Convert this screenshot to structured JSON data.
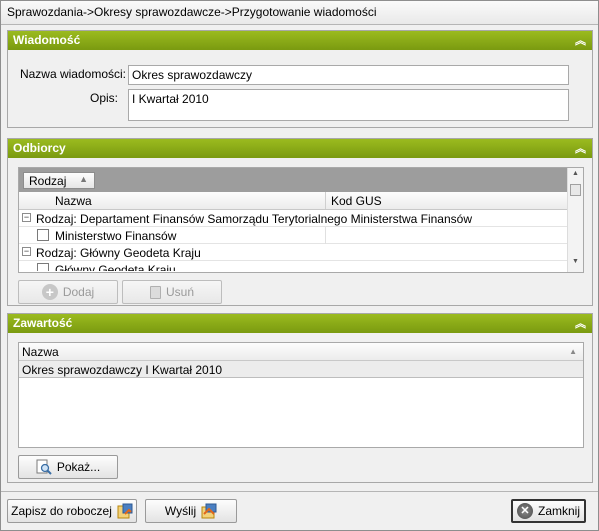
{
  "window": {
    "title": "Sprawozdania->Okresy sprawozdawcze->Przygotowanie wiadomości"
  },
  "message_group": {
    "header": "Wiadomość",
    "name_label": "Nazwa wiadomości:",
    "name_value": "Okres sprawozdawczy",
    "desc_label": "Opis:",
    "desc_value": "I Kwartał 2010"
  },
  "recipients_group": {
    "header": "Odbiorcy",
    "group_by_chip": "Rodzaj",
    "columns": [
      "Nazwa",
      "Kod GUS"
    ],
    "groups": [
      {
        "group_label": "Rodzaj:  Departament Finansów Samorządu Terytorialnego Ministerstwa Finansów",
        "rows": [
          {
            "name": "Ministerstwo Finansów",
            "code": ""
          }
        ]
      },
      {
        "group_label": "Rodzaj:  Główny Geodeta Kraju",
        "rows": [
          {
            "name": "Główny Geodeta Kraju",
            "code": ""
          }
        ]
      }
    ],
    "add_button": "Dodaj",
    "remove_button": "Usuń"
  },
  "content_group": {
    "header": "Zawartość",
    "column": "Nazwa",
    "rows": [
      "Okres sprawozdawczy I Kwartał 2010"
    ],
    "show_button": "Pokaż..."
  },
  "footer": {
    "save_draft_button": "Zapisz do roboczej",
    "send_button": "Wyślij",
    "close_button": "Zamknij"
  },
  "colors": {
    "group_header": "#8aa917",
    "selected_row": "#ececec"
  },
  "icons": [
    "collapse-chevron-icon",
    "expand-collapse-icon",
    "checkbox-icon",
    "sort-arrow-icon",
    "add-icon",
    "trash-icon",
    "preview-icon",
    "save-icon",
    "send-icon",
    "close-icon"
  ]
}
